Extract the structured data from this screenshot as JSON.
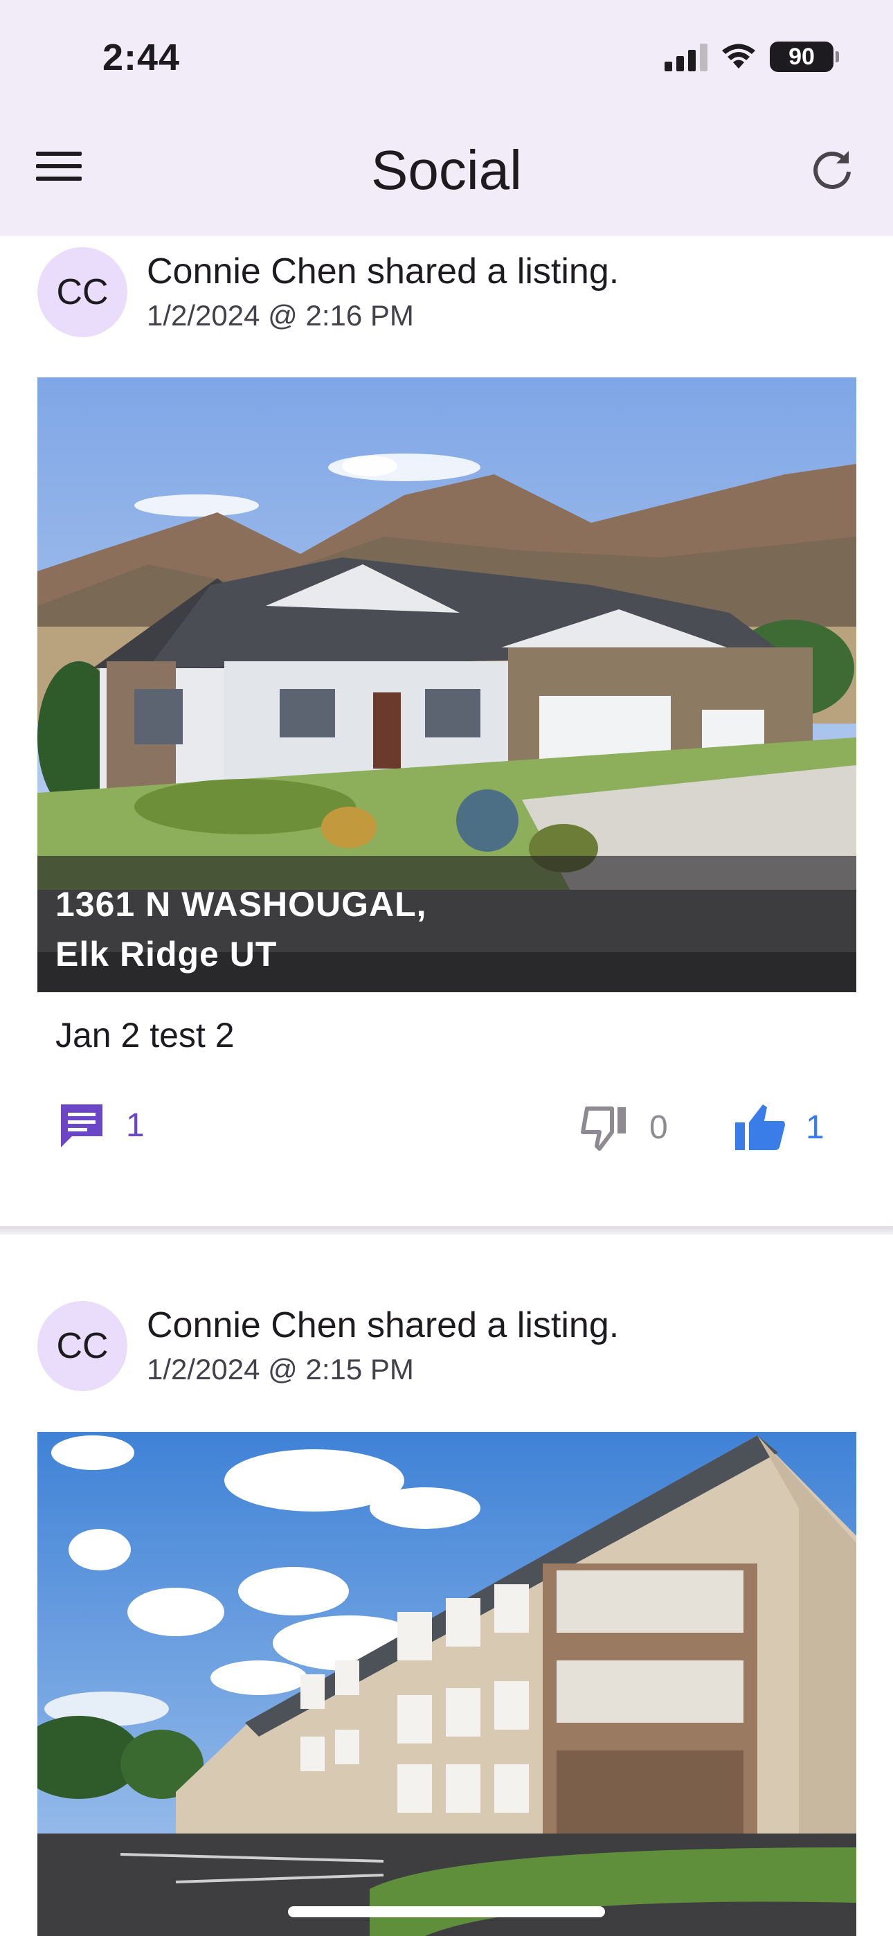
{
  "status_bar": {
    "time": "2:44",
    "battery": "90"
  },
  "header": {
    "title": "Social",
    "menu_icon": "menu-icon",
    "refresh_icon": "refresh-icon"
  },
  "posts": [
    {
      "avatar_initials": "CC",
      "headline": "Connie Chen shared a listing.",
      "timestamp": "1/2/2024 @ 2:16 PM",
      "address_line1": "1361 N WASHOUGAL,",
      "address_line2": "Elk Ridge UT",
      "text": "Jan 2 test 2",
      "comments": "1",
      "dislikes": "0",
      "likes": "1"
    },
    {
      "avatar_initials": "CC",
      "headline": "Connie Chen shared a listing.",
      "timestamp": "1/2/2024 @ 2:15 PM"
    }
  ],
  "colors": {
    "appbar": "#f1ecf8",
    "avatar_bg": "#eadcfb",
    "comment": "#6b47c7",
    "like": "#3a7de8",
    "dislike": "#8d8b91"
  }
}
